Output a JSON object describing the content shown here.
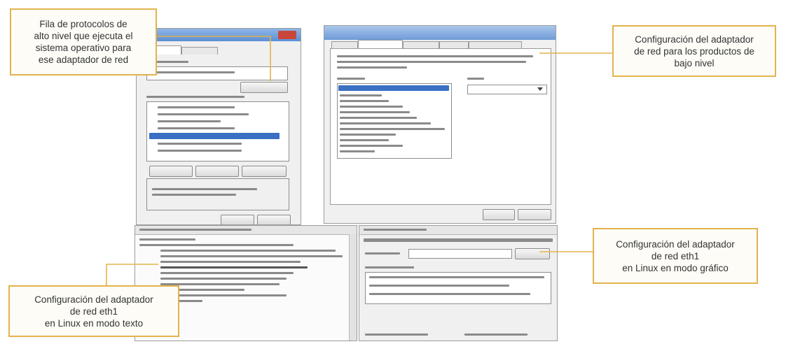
{
  "callouts": {
    "protocols": {
      "lines": [
        "Fila de protocolos de",
        "alto nivel que ejecuta el",
        "sistema operativo para",
        "ese adaptador de red"
      ]
    },
    "adapter_low_level": {
      "lines": [
        "Configuración del adaptador",
        "de red para los productos de",
        "bajo nivel"
      ]
    },
    "linux_gui": {
      "lines": [
        "Configuración del adaptador",
        "de red eth1",
        "en Linux en modo gráfico"
      ]
    },
    "linux_text": {
      "lines": [
        "Configuración del adaptador",
        "de red eth1",
        "en Linux en modo texto"
      ]
    }
  },
  "colors": {
    "callout_border": "#e3b34b",
    "connector": "#e3b34b",
    "title_bar_blue": "#5b8fd6",
    "selection_blue": "#3a6fc4"
  }
}
